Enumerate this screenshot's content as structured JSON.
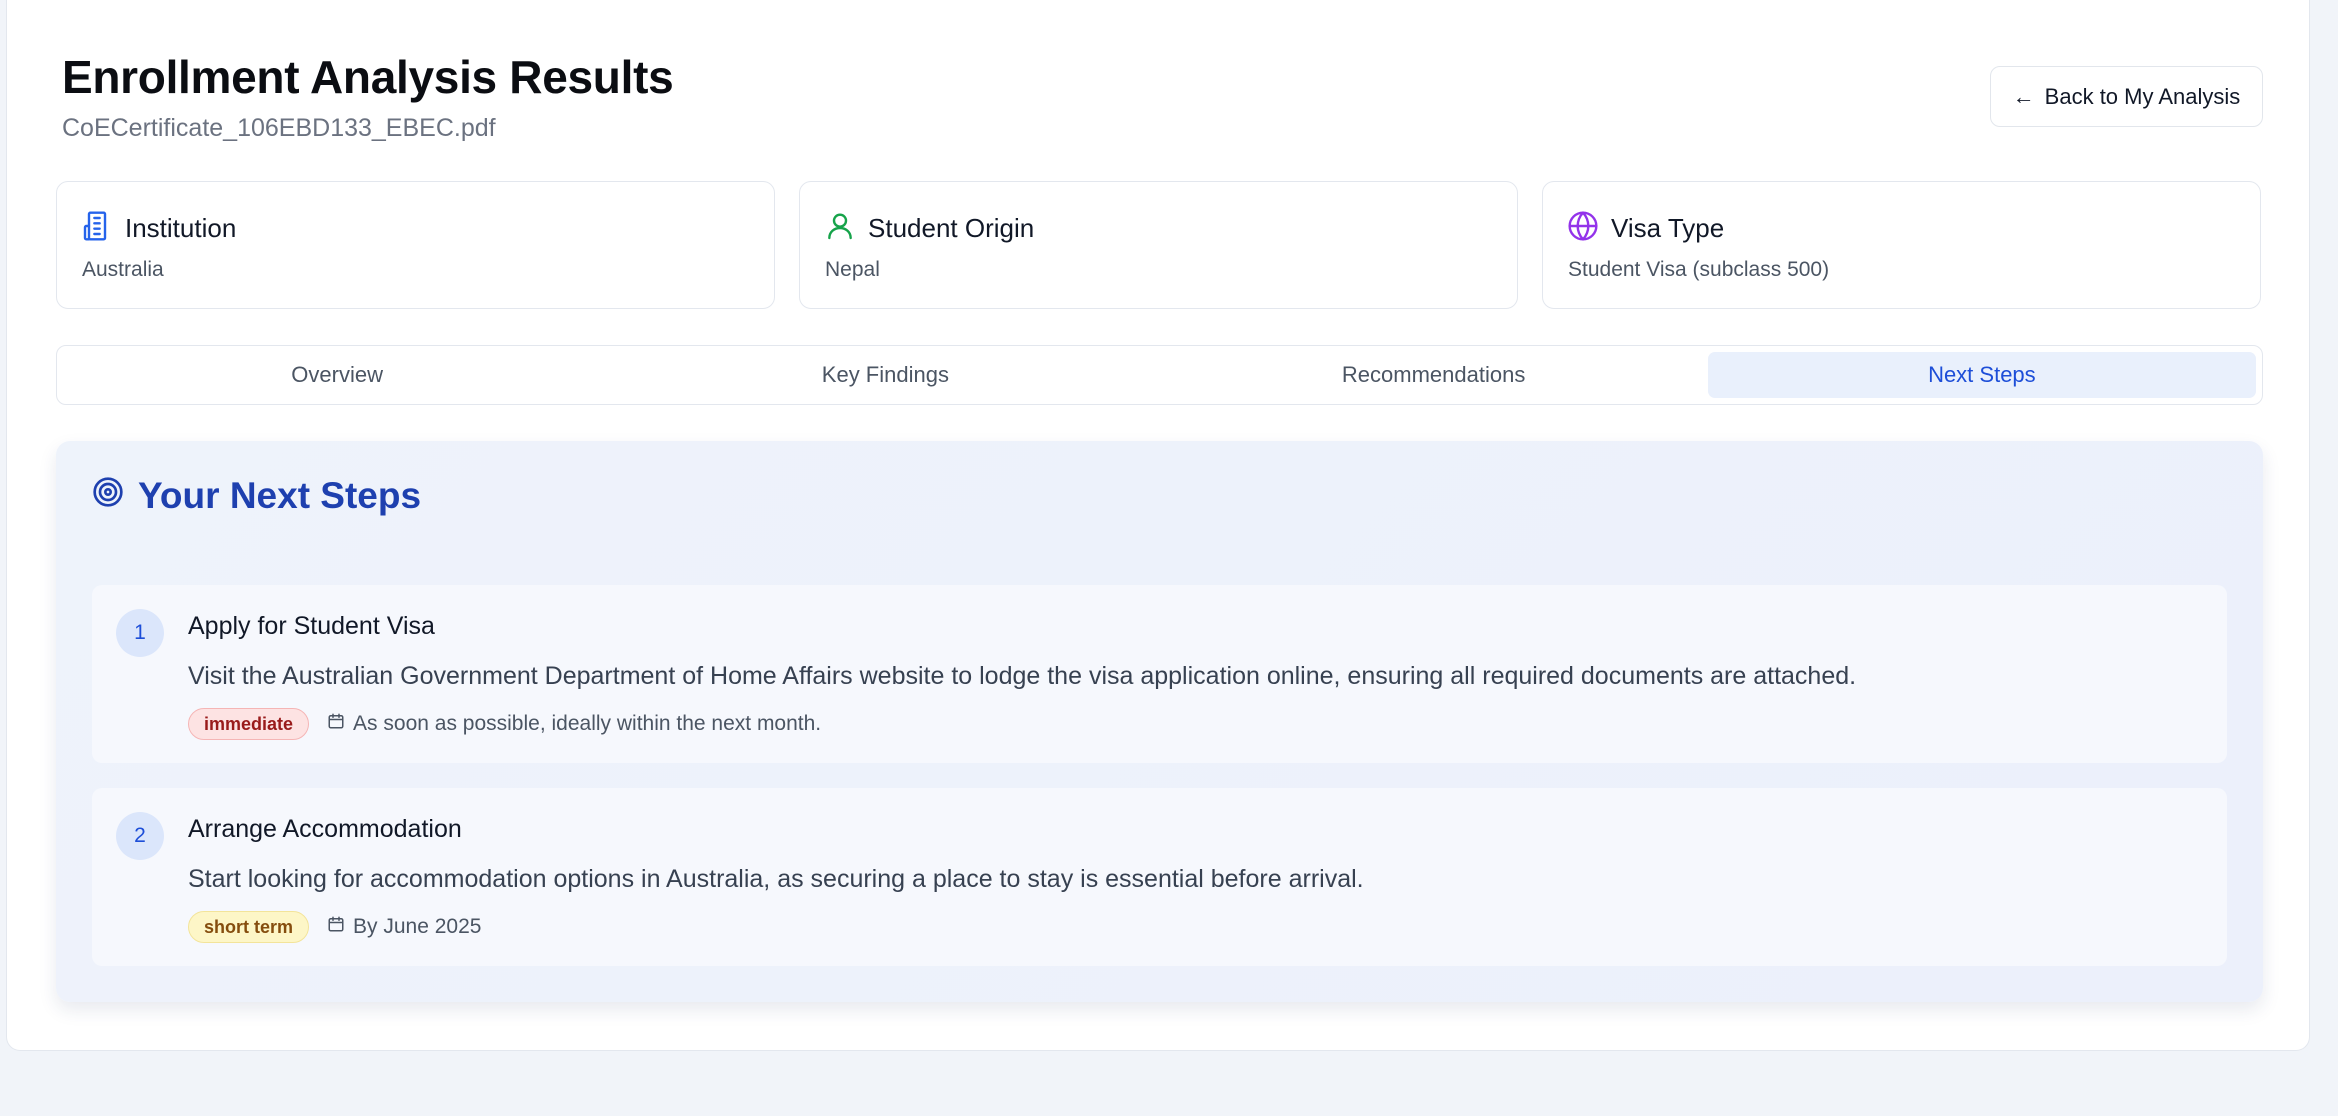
{
  "header": {
    "title": "Enrollment Analysis Results",
    "file_name": "CoECertificate_106EBD133_EBEC.pdf",
    "back_button_label": "Back to My Analysis"
  },
  "info_cards": [
    {
      "label": "Institution",
      "value": "Australia",
      "icon": "building-icon",
      "icon_color": "#2563eb"
    },
    {
      "label": "Student Origin",
      "value": "Nepal",
      "icon": "user-icon",
      "icon_color": "#16a34a"
    },
    {
      "label": "Visa Type",
      "value": "Student Visa (subclass 500)",
      "icon": "globe-icon",
      "icon_color": "#9333ea"
    }
  ],
  "tabs": [
    {
      "label": "Overview",
      "active": false
    },
    {
      "label": "Key Findings",
      "active": false
    },
    {
      "label": "Recommendations",
      "active": false
    },
    {
      "label": "Next Steps",
      "active": true
    }
  ],
  "next_steps": {
    "title": "Your Next Steps",
    "steps": [
      {
        "number": "1",
        "title": "Apply for Student Visa",
        "description": "Visit the Australian Government Department of Home Affairs website to lodge the visa application online, ensuring all required documents are attached.",
        "priority": "immediate",
        "timeline": "As soon as possible, ideally within the next month."
      },
      {
        "number": "2",
        "title": "Arrange Accommodation",
        "description": "Start looking for accommodation options in Australia, as securing a place to stay is essential before arrival.",
        "priority": "short term",
        "timeline": "By June 2025"
      }
    ]
  },
  "colors": {
    "accent": "#1d4ed8",
    "heading_blue": "#1e40af",
    "priority_immediate": "#fde3e3",
    "priority_short_term": "#fdf6c7"
  }
}
